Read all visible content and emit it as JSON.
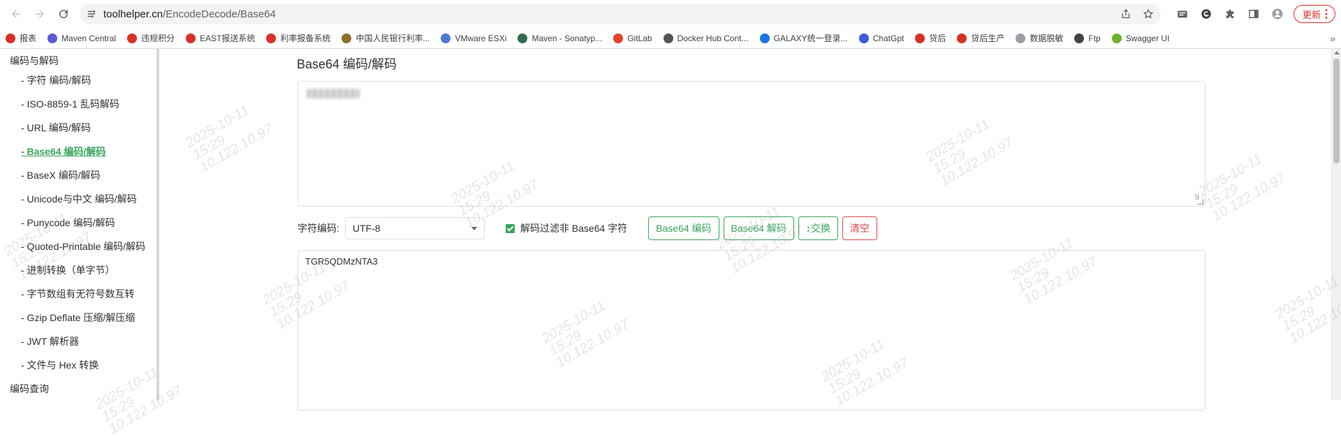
{
  "browser": {
    "url_host": "toolhelper.cn",
    "url_path": "/EncodeDecode/Base64",
    "update_label": "更新"
  },
  "bookmarks": [
    {
      "label": "报表",
      "color": "#d93025"
    },
    {
      "label": "Maven Central",
      "color": "#5b5bd6"
    },
    {
      "label": "违规积分",
      "color": "#d93025"
    },
    {
      "label": "EAST报送系统",
      "color": "#d93025"
    },
    {
      "label": "利率报备系统",
      "color": "#d93025"
    },
    {
      "label": "中国人民银行利率...",
      "color": "#8b6f2f"
    },
    {
      "label": "VMware ESXi",
      "color": "#4a7bd0"
    },
    {
      "label": "Maven - Sonatyp...",
      "color": "#2e6b4f"
    },
    {
      "label": "GitLab",
      "color": "#e24329"
    },
    {
      "label": "Docker Hub Cont...",
      "color": "#555555"
    },
    {
      "label": "GALAXY统一登录...",
      "color": "#1a73e8"
    },
    {
      "label": "ChatGpt",
      "color": "#3b5bdb"
    },
    {
      "label": "贷后",
      "color": "#d93025"
    },
    {
      "label": "贷后生产",
      "color": "#d93025"
    },
    {
      "label": "数据脱敏",
      "color": "#9aa0a6"
    },
    {
      "label": "Ftp",
      "color": "#444444"
    },
    {
      "label": "Swagger UI",
      "color": "#6ab42d"
    }
  ],
  "bookmarks_more": "»",
  "sidebar": {
    "group_encode": "编码与解码",
    "items": [
      {
        "label": "- 字符  编码/解码"
      },
      {
        "label": "- ISO-8859-1 乱码解码"
      },
      {
        "label": "- URL  编码/解码"
      },
      {
        "label": "- Base64  编码/解码"
      },
      {
        "label": "- BaseX  编码/解码"
      },
      {
        "label": "- Unicode与中文  编码/解码"
      },
      {
        "label": "- Punycode  编码/解码"
      },
      {
        "label": "- Quoted-Printable  编码/解码"
      },
      {
        "label": "- 进制转换（单字节）"
      },
      {
        "label": "- 字节数组有无符号数互转"
      },
      {
        "label": "- Gzip Deflate 压缩/解压缩"
      },
      {
        "label": "- JWT 解析器"
      },
      {
        "label": "- 文件与 Hex 转换"
      }
    ],
    "group_query": "编码查询"
  },
  "main": {
    "title": "Base64 编码/解码",
    "input_counter": "9",
    "charset_label": "字符编码:",
    "charset_value": "UTF-8",
    "filter_label": "解码过滤非 Base64 字符",
    "encode_button": "Base64 编码",
    "decode_button": "Base64 解码",
    "swap_button": "↕交换",
    "clear_button": "清空",
    "output_text": "TGR5QDMzNTA3"
  },
  "watermark": "2025-10-11\n15:29\n10.122.10.97"
}
